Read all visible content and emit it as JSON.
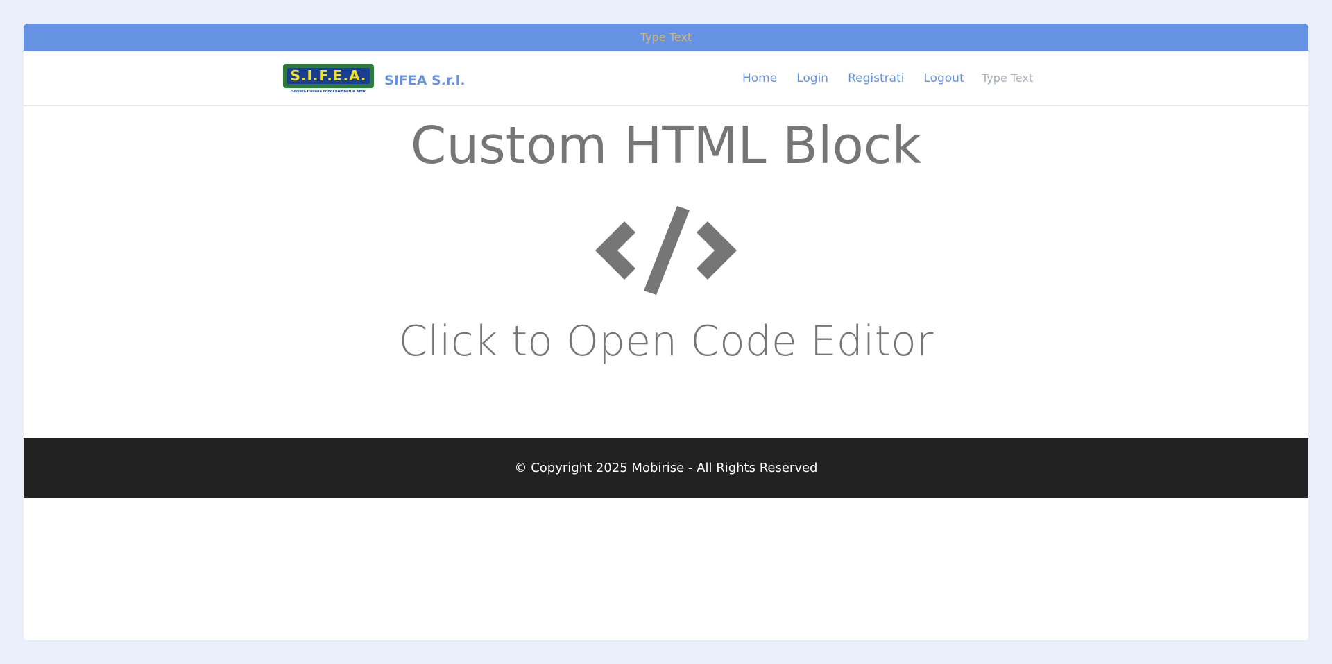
{
  "topbar": {
    "text": "Type Text",
    "text_color": "#d9b96a",
    "background": "#6592e2"
  },
  "navbar": {
    "logo": {
      "text": "S.I.F.E.A.",
      "subtitle": "Società Italiana Fondi Bombati e Affini"
    },
    "brand_name": "SIFEA S.r.l.",
    "links": [
      {
        "label": "Home"
      },
      {
        "label": "Login"
      },
      {
        "label": "Registrati"
      },
      {
        "label": "Logout"
      }
    ],
    "extra_text": "Type Text",
    "accent": "#6592e2"
  },
  "content": {
    "title": "Custom HTML Block",
    "icon": "code-icon",
    "subtitle": "Click to Open Code Editor",
    "text_color": "#767676"
  },
  "footer": {
    "copyright": "© Copyright 2025 Mobirise - All Rights Reserved",
    "background": "#222222"
  }
}
